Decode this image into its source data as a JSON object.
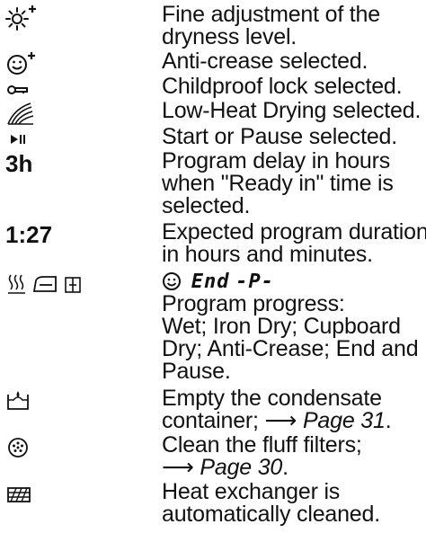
{
  "rows": [
    {
      "icon": "dryness-adjust-icon",
      "lines": [
        "Fine adjustment of the",
        "dryness level."
      ]
    },
    {
      "icon": "anti-crease-icon",
      "lines": [
        "Anti-crease selected."
      ]
    },
    {
      "icon": "childproof-lock-icon",
      "lines": [
        "Childproof lock selected."
      ]
    },
    {
      "icon": "low-heat-icon",
      "lines": [
        "Low-Heat Drying selected."
      ]
    },
    {
      "icon": "start-pause-icon",
      "lines": [
        "Start or Pause selected."
      ]
    },
    {
      "symbol": "3h",
      "lines": [
        "Program delay in hours",
        "when \"Ready in\" time is",
        "selected."
      ]
    },
    {
      "symbol": "1:27",
      "lines": [
        "Expected program duration",
        "in hours and minutes."
      ]
    },
    {
      "icons": [
        "wet-icon",
        "iron-dry-icon",
        "cupboard-dry-icon"
      ],
      "display": {
        "icon": "anti-crease-icon",
        "end_text": "End",
        "pause_text": "-P-"
      },
      "lines": [
        "Program progress:",
        "Wet; Iron Dry; Cupboard",
        "Dry; Anti-Crease; End and",
        "Pause."
      ]
    },
    {
      "icon": "empty-condensate-icon",
      "lines": [
        "Empty the condensate"
      ],
      "ref_prefix": "container; ",
      "ref_arrow": "⟶",
      "ref_text": "Page 31",
      "ref_suffix": "."
    },
    {
      "icon": "fluff-filter-icon",
      "lines": [
        "Clean the fluff filters;"
      ],
      "ref_arrow": "⟶",
      "ref_text": "Page 30",
      "ref_suffix": "."
    },
    {
      "icon": "heat-exchanger-icon",
      "lines": [
        "Heat exchanger is",
        "automatically cleaned."
      ]
    }
  ]
}
